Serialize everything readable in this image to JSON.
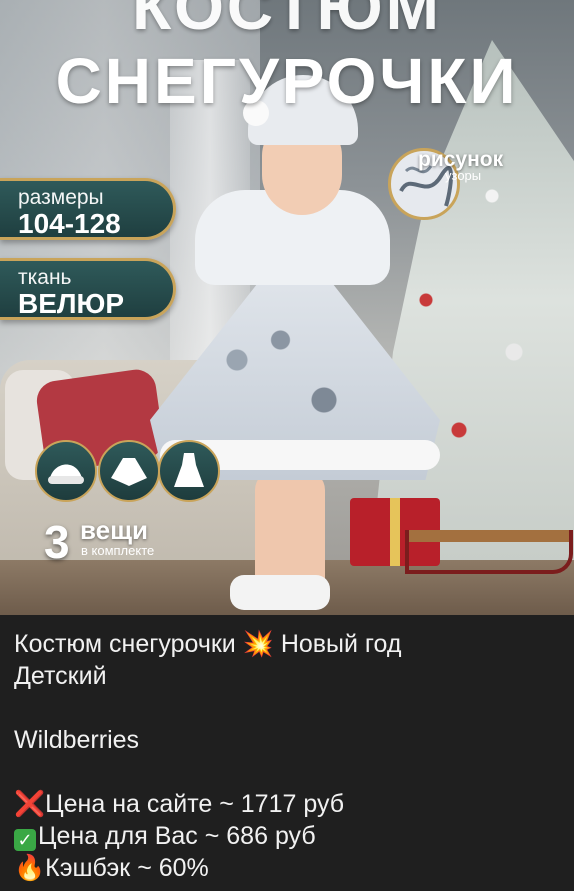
{
  "post": {
    "image": {
      "title_line1": "КОСТЮМ",
      "title_line2": "СНЕГУРОЧКИ",
      "sizes_label": "размеры",
      "sizes_value": "104-128",
      "fabric_label": "ткань",
      "fabric_value": "ВЕЛЮР",
      "pattern_title": "рисунок",
      "pattern_sub": "узоры",
      "bundle_count": "3",
      "bundle_word": "вещи",
      "bundle_sub": "в комплекте",
      "icons": [
        "hat-icon",
        "cape-icon",
        "dress-icon"
      ]
    },
    "caption": {
      "line1_a": "Костюм снегурочки",
      "line1_emoji": "💥",
      "line1_b": "Новый год",
      "line2": "Детский",
      "shop": "Wildberries",
      "price_site_icon": "❌",
      "price_site": "Цена на сайте ~ 1717 руб",
      "price_you_icon": "✓",
      "price_you": "Цена для Вас ~ 686 руб",
      "cashback_icon": "🔥",
      "cashback": "Кэшбэк ~ 60%"
    }
  },
  "colors": {
    "background": "#1f1f1f",
    "text": "#f1f1f1",
    "badge_teal": "#2f5a5a",
    "badge_gold": "#c9a45a",
    "red": "#e53935",
    "green": "#3aa845"
  }
}
